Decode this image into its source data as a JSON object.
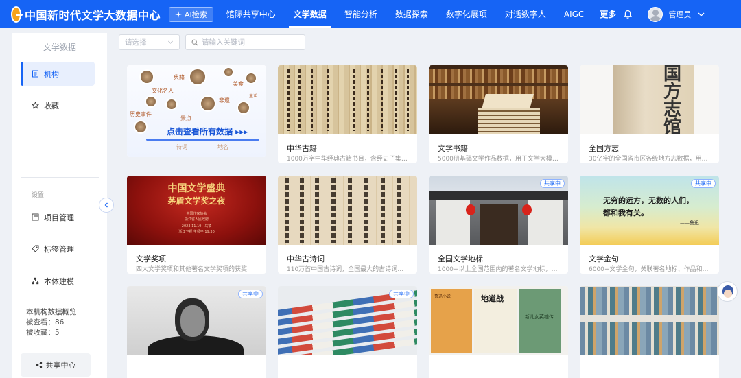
{
  "brand": {
    "title": "中国新时代文学大数据中心"
  },
  "header": {
    "ai_search": "AI检索",
    "nav": [
      {
        "label": "馆际共享中心",
        "active": false
      },
      {
        "label": "文学数据",
        "active": true
      },
      {
        "label": "智能分析",
        "active": false
      },
      {
        "label": "数据探索",
        "active": false
      },
      {
        "label": "数字化展项",
        "active": false
      },
      {
        "label": "对话数字人",
        "active": false
      },
      {
        "label": "AIGC",
        "active": false
      }
    ],
    "more": "更多",
    "user_name": "管理员"
  },
  "sidebar": {
    "title": "文学数据",
    "items": [
      {
        "label": "机构",
        "icon": "document-icon"
      },
      {
        "label": "收藏",
        "icon": "star-icon"
      }
    ],
    "settings_label": "设置",
    "settings_items": [
      {
        "label": "项目管理",
        "icon": "project-icon"
      },
      {
        "label": "标签管理",
        "icon": "tag-icon"
      },
      {
        "label": "本体建模",
        "icon": "hierarchy-icon"
      }
    ],
    "stats_title": "本机构数据概览",
    "stats_viewed": "被查看：86",
    "stats_favorited": "被收藏：5",
    "share_center": "共享中心"
  },
  "filters": {
    "select_placeholder": "请选择",
    "search_placeholder": "请输入关键词"
  },
  "all_card": {
    "cta": "点击查看所有数据 ▸▸▸",
    "words": [
      "典籍",
      "美食",
      "文化名人",
      "非遗",
      "历史事件",
      "景点",
      "诗词",
      "地名",
      "童谣"
    ]
  },
  "cards": [
    {
      "title": "中华古籍",
      "desc": "1000万字中华经典古籍书目，含经史子集…",
      "shared": false,
      "art": "scroll"
    },
    {
      "title": "文学书籍",
      "desc": "5000册基础文学作品数据，用于文学大模…",
      "shared": false,
      "art": "shelf"
    },
    {
      "title": "全国方志",
      "desc": "30亿字的全国省市区各级地方志数据，用…",
      "shared": false,
      "art": "fangzhi",
      "cover_text": "国方志馆"
    },
    {
      "title": "文学奖项",
      "desc": "四大文学奖项和其他著名文学奖项的获奖…",
      "shared": false,
      "art": "award",
      "poster": {
        "h1": "中国文学盛典",
        "h2": "茅盾文学奖之夜",
        "org1": "中国作家协会",
        "org2": "浙江省人民政府",
        "date": "2023.11.19 · 乌镇",
        "venue": "浙江卫视 主频平 19:30"
      }
    },
    {
      "title": "中华古诗词",
      "desc": "110万首中国古诗词，全国最大的古诗词数…",
      "shared": false,
      "art": "poem"
    },
    {
      "title": "全国文学地标",
      "desc": "1000+以上全国范围内的著名文学地标，…",
      "shared": true,
      "art": "landmark"
    },
    {
      "title": "文学金句",
      "desc": "6000+文学金句，关联著名地标、作品和…",
      "shared": true,
      "art": "quote",
      "quote": {
        "line1": "无穷的远方，无数的人们，",
        "line2": "都和我有关。",
        "author": "——鲁迅"
      }
    },
    {
      "title": "",
      "desc": "",
      "shared": true,
      "art": "portrait"
    },
    {
      "title": "",
      "desc": "",
      "shared": true,
      "art": "mags"
    },
    {
      "title": "",
      "desc": "",
      "shared": false,
      "art": "covers",
      "cover_texts": [
        "鲁迅小说",
        "地道战",
        "新儿女英雄传"
      ]
    },
    {
      "title": "",
      "desc": "",
      "shared": false,
      "art": "bookshelf"
    }
  ],
  "shared_badge": "共享中",
  "colors": {
    "primary": "#1664f5",
    "page_bg": "#eef1f6"
  }
}
